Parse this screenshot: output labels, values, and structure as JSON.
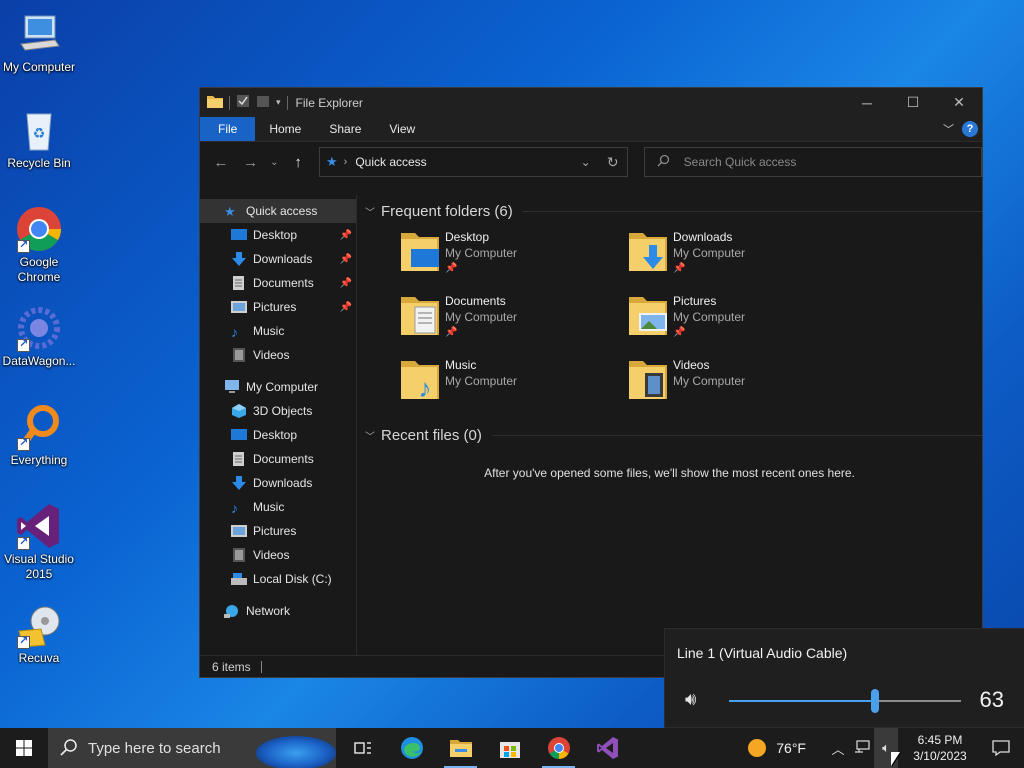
{
  "desktop": {
    "icons": [
      {
        "label": "My Computer"
      },
      {
        "label": "Recycle Bin"
      },
      {
        "label": "Google Chrome"
      },
      {
        "label": "DataWagon..."
      },
      {
        "label": "Everything"
      },
      {
        "label": "Visual Studio 2015"
      },
      {
        "label": "Recuva"
      }
    ]
  },
  "explorer": {
    "title": "File Explorer",
    "ribbon_tabs": [
      "File",
      "Home",
      "Share",
      "View"
    ],
    "address": "Quick access",
    "search_placeholder": "Search Quick access",
    "nav": {
      "quick_access": "Quick access",
      "quick_items": [
        "Desktop",
        "Downloads",
        "Documents",
        "Pictures",
        "Music",
        "Videos"
      ],
      "my_computer": "My Computer",
      "computer_items": [
        "3D Objects",
        "Desktop",
        "Documents",
        "Downloads",
        "Music",
        "Pictures",
        "Videos",
        "Local Disk (C:)"
      ],
      "network": "Network"
    },
    "frequent_header": "Frequent folders (6)",
    "frequent": [
      {
        "name": "Desktop",
        "location": "My Computer",
        "pinned": true
      },
      {
        "name": "Downloads",
        "location": "My Computer",
        "pinned": true
      },
      {
        "name": "Documents",
        "location": "My Computer",
        "pinned": true
      },
      {
        "name": "Pictures",
        "location": "My Computer",
        "pinned": true
      },
      {
        "name": "Music",
        "location": "My Computer",
        "pinned": false
      },
      {
        "name": "Videos",
        "location": "My Computer",
        "pinned": false
      }
    ],
    "recent_header": "Recent files (0)",
    "recent_message": "After you've opened some files, we'll show the most recent ones here.",
    "status": "6 items"
  },
  "volume": {
    "device": "Line 1 (Virtual Audio Cable)",
    "level": 63
  },
  "taskbar": {
    "search_placeholder": "Type here to search",
    "weather": "76°F",
    "time": "6:45 PM",
    "date": "3/10/2023"
  },
  "colors": {
    "accent": "#1a63c6",
    "slider": "#4aa0ea"
  }
}
